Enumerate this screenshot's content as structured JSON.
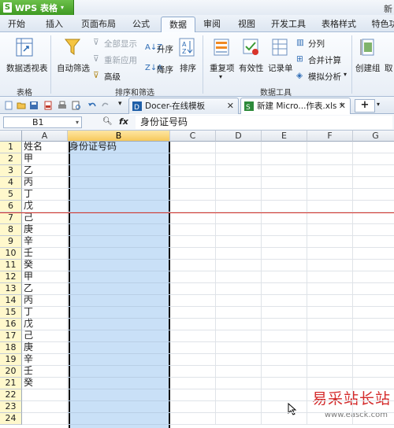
{
  "app": {
    "title": "WPS 表格",
    "title_right": "新"
  },
  "menu_tabs": [
    "开始",
    "插入",
    "页面布局",
    "公式",
    "数据",
    "审阅",
    "视图",
    "开发工具",
    "表格样式",
    "特色功"
  ],
  "active_tab": "数据",
  "ribbon": {
    "pivot_label": "数据透视表",
    "group_table": "表格",
    "autofilter_label": "自动筛选",
    "show_all_label": "全部显示",
    "reapply_label": "重新应用",
    "advanced_label": "高级",
    "sort_asc_label": "升序",
    "sort_desc_label": "降序",
    "sort_label": "排序",
    "group_sort_filter": "排序和筛选",
    "duplicates_label": "重复项",
    "validity_label": "有效性",
    "record_label": "记录单",
    "split_label": "分列",
    "consolidate_label": "合并计算",
    "whatif_label": "模拟分析",
    "group_data_tools": "数据工具",
    "create_group_label": "创建组",
    "cancel_label": "取"
  },
  "doc_tabs": [
    {
      "label": "Docer-在线模板",
      "active": false
    },
    {
      "label": "新建 Micro...作表.xls *",
      "active": true
    }
  ],
  "formula_bar": {
    "cell_ref": "B1",
    "content": "身份证号码"
  },
  "columns": [
    "A",
    "B",
    "C",
    "D",
    "E",
    "F",
    "G"
  ],
  "selected_column": "B",
  "rows": [
    {
      "num": "1",
      "a": "姓名",
      "b": "身份证号码"
    },
    {
      "num": "2",
      "a": "甲",
      "b": ""
    },
    {
      "num": "3",
      "a": "乙",
      "b": ""
    },
    {
      "num": "4",
      "a": "丙",
      "b": ""
    },
    {
      "num": "5",
      "a": "丁",
      "b": ""
    },
    {
      "num": "6",
      "a": "戊",
      "b": ""
    },
    {
      "num": "7",
      "a": "己",
      "b": ""
    },
    {
      "num": "8",
      "a": "庚",
      "b": ""
    },
    {
      "num": "9",
      "a": "辛",
      "b": ""
    },
    {
      "num": "10",
      "a": "壬",
      "b": ""
    },
    {
      "num": "11",
      "a": "癸",
      "b": ""
    },
    {
      "num": "12",
      "a": "甲",
      "b": ""
    },
    {
      "num": "13",
      "a": "乙",
      "b": ""
    },
    {
      "num": "14",
      "a": "丙",
      "b": ""
    },
    {
      "num": "15",
      "a": "丁",
      "b": ""
    },
    {
      "num": "16",
      "a": "戊",
      "b": ""
    },
    {
      "num": "17",
      "a": "己",
      "b": ""
    },
    {
      "num": "18",
      "a": "庚",
      "b": ""
    },
    {
      "num": "19",
      "a": "辛",
      "b": ""
    },
    {
      "num": "20",
      "a": "壬",
      "b": ""
    },
    {
      "num": "21",
      "a": "癸",
      "b": ""
    },
    {
      "num": "22",
      "a": "",
      "b": ""
    },
    {
      "num": "23",
      "a": "",
      "b": ""
    },
    {
      "num": "24",
      "a": "",
      "b": ""
    }
  ],
  "watermark": {
    "text": "易采站长站",
    "url": "www.easck.com",
    "color": "#d42a2a"
  }
}
